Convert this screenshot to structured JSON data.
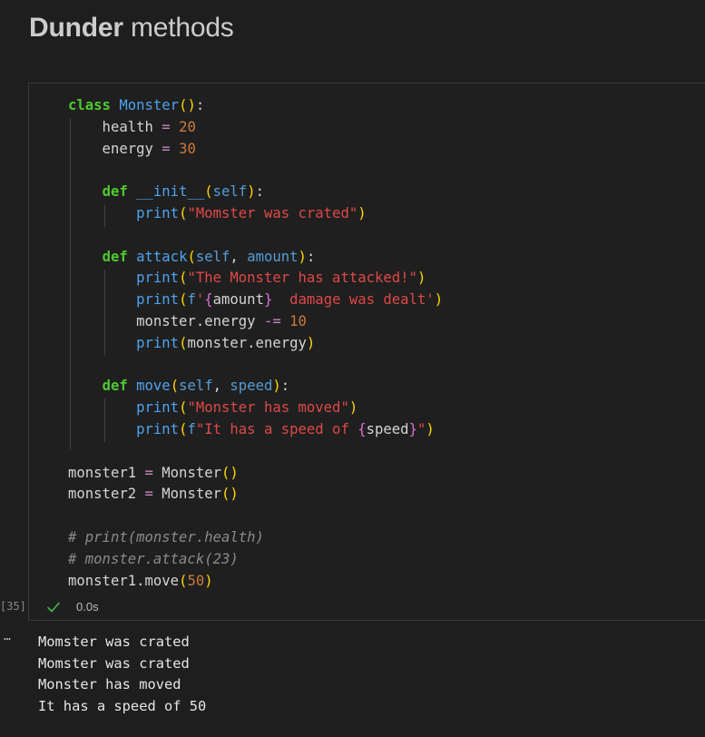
{
  "markdown": {
    "title_bold": "Dunder",
    "title_rest": " methods"
  },
  "cell": {
    "exec_count": "[35]",
    "status_icon": "check-icon",
    "exec_time": "0.0s",
    "code_lines": [
      "class Monster():",
      "    health = 20",
      "    energy = 30",
      "",
      "    def __init__(self):",
      "        print(\"Momster was crated\")",
      "",
      "    def attack(self, amount):",
      "        print(\"The Monster has attacked!\")",
      "        print(f'{amount}  damage was dealt')",
      "        monster.energy -= 10",
      "        print(monster.energy)",
      "",
      "    def move(self, speed):",
      "        print(\"Monster has moved\")",
      "        print(f\"It has a speed of {speed}\")",
      "",
      "monster1 = Monster()",
      "monster2 = Monster()",
      "",
      "# print(monster.health)",
      "# monster.attack(23)",
      "monster1.move(50)"
    ]
  },
  "output": {
    "prompt": "…",
    "lines": [
      "Momster was crated",
      "Momster was crated",
      "Monster has moved",
      "It has a speed of 50"
    ]
  },
  "colors": {
    "background": "#1e1e1e",
    "keyword": "#4ec92f",
    "function": "#4ea3f0",
    "number": "#ce7a3e",
    "string": "#e04848",
    "operator": "#c586c0",
    "comment": "#8a8a8a",
    "bracket_level1": "#ffd700",
    "bracket_level2": "#da70d6"
  }
}
